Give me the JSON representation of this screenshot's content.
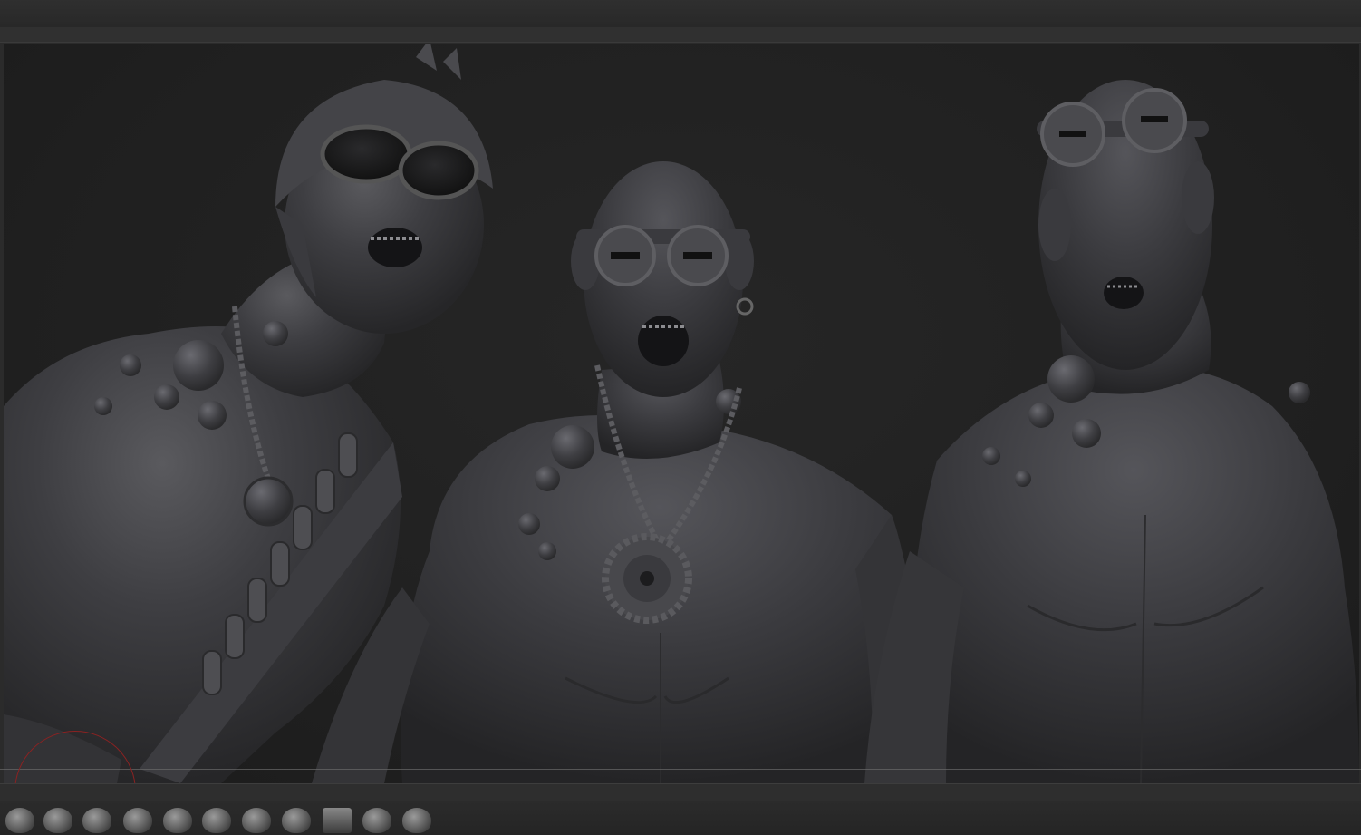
{
  "app": {
    "accent": "#8a2222",
    "viewport_bg": "#1f1f1f",
    "sculpt_color": "#3d3d3f"
  },
  "viewport": {
    "content": "three-sculpted-busts",
    "figures": [
      {
        "id": "left",
        "accessories": [
          "helmet",
          "aviator-goggles",
          "chain-necklace",
          "bandolier"
        ]
      },
      {
        "id": "center",
        "accessories": [
          "welding-goggles",
          "gear-pendant-necklace",
          "earring"
        ]
      },
      {
        "id": "right",
        "accessories": [
          "goggles-on-forehead"
        ]
      }
    ]
  },
  "brush_shelf": {
    "icons": [
      "standard-brush-icon",
      "clay-brush-icon",
      "move-brush-icon",
      "inflate-brush-icon",
      "smooth-brush-icon",
      "pinch-brush-icon",
      "dam-standard-brush-icon",
      "flatten-brush-icon",
      "trim-brush-icon",
      "polish-brush-icon",
      "snakehook-brush-icon"
    ]
  }
}
